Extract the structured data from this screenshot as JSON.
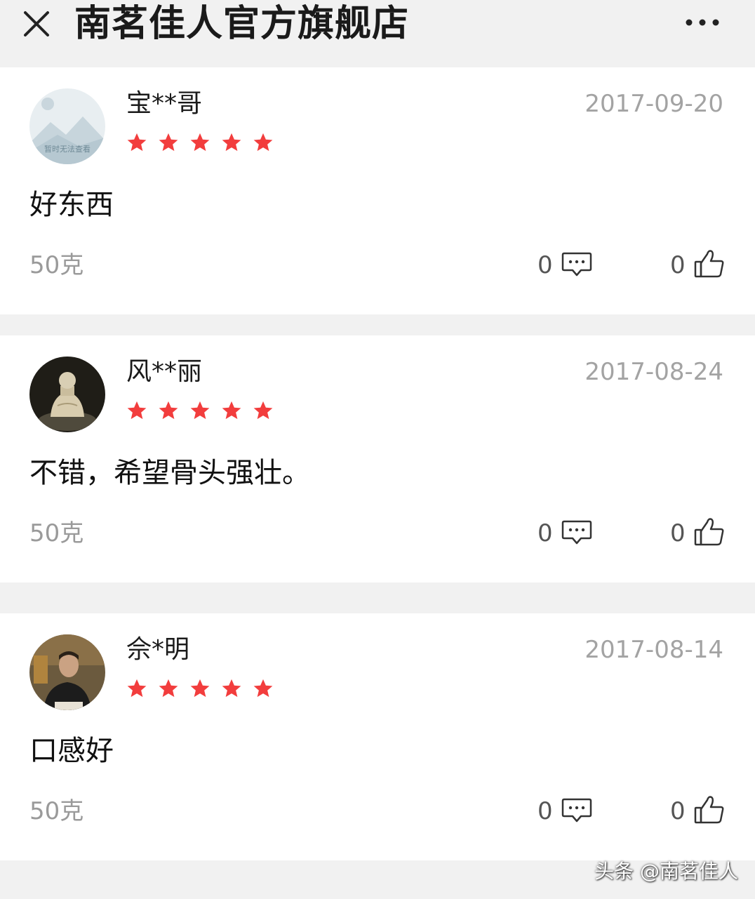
{
  "header": {
    "title": "南茗佳人官方旗舰店",
    "close_icon": "close-icon",
    "more_icon": "more-icon"
  },
  "reviews": [
    {
      "username": "宝**哥",
      "date": "2017-09-20",
      "rating": 5,
      "content": "好东西",
      "spec": "50克",
      "comment_count": "0",
      "like_count": "0",
      "avatar": "placeholder-avatar",
      "avatar_text": "暂时无法查看"
    },
    {
      "username": "风**丽",
      "date": "2017-08-24",
      "rating": 5,
      "content": "不错，希望骨头强壮。",
      "spec": "50克",
      "comment_count": "0",
      "like_count": "0",
      "avatar": "buddha-statue-avatar"
    },
    {
      "username": "佘*明",
      "date": "2017-08-14",
      "rating": 5,
      "content": "口感好",
      "spec": "50克",
      "comment_count": "0",
      "like_count": "0",
      "avatar": "man-portrait-avatar"
    }
  ],
  "watermark": "头条 @南茗佳人",
  "colors": {
    "star": "#f23d3d",
    "background": "#f1f1f1",
    "card": "#ffffff",
    "date": "#a3a3a3",
    "spec": "#9a9a9a"
  }
}
